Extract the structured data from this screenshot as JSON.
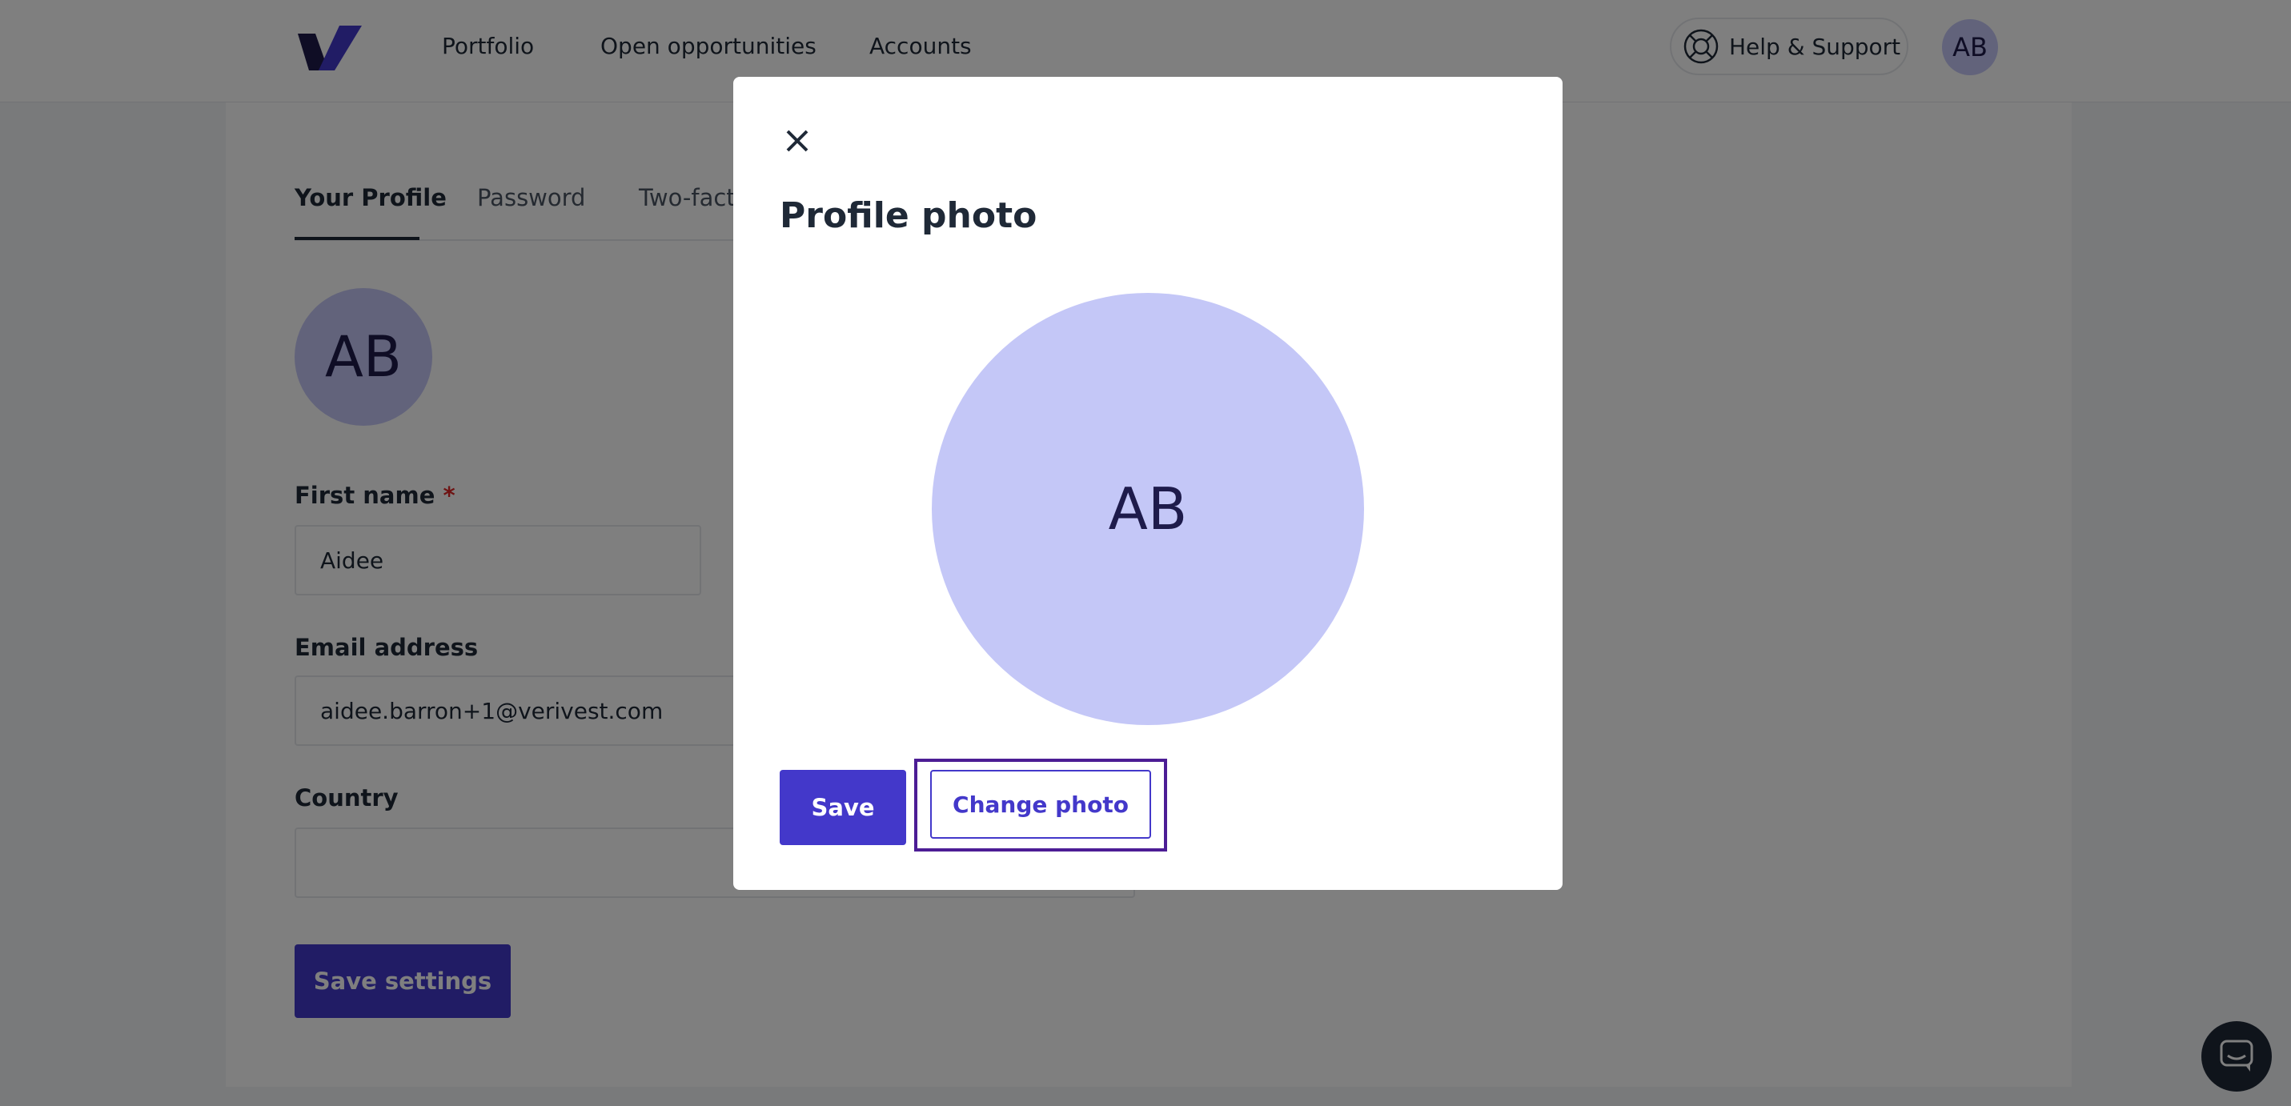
{
  "nav": {
    "links": [
      "Portfolio",
      "Open opportunities",
      "Accounts"
    ],
    "help_label": "Help & Support",
    "avatar_initials": "AB"
  },
  "tabs": [
    "Your Profile",
    "Password",
    "Two-fact"
  ],
  "profile": {
    "avatar_initials": "AB",
    "first_name_label": "First name",
    "required_mark": "*",
    "first_name_value": "Aidee",
    "email_label": "Email address",
    "email_value": "aidee.barron+1@verivest.com",
    "country_label": "Country",
    "country_value": "",
    "save_settings_label": "Save settings"
  },
  "modal": {
    "title": "Profile photo",
    "avatar_initials": "AB",
    "save_label": "Save",
    "change_photo_label": "Change photo"
  },
  "colors": {
    "brand": "#4338ca",
    "avatar_bg": "#c4c7f7",
    "focus_ring": "#4c1d95"
  },
  "icons": {
    "logo": "verivest-logo-icon",
    "help": "lifebuoy-icon",
    "close": "close-icon",
    "chat": "chat-icon"
  }
}
